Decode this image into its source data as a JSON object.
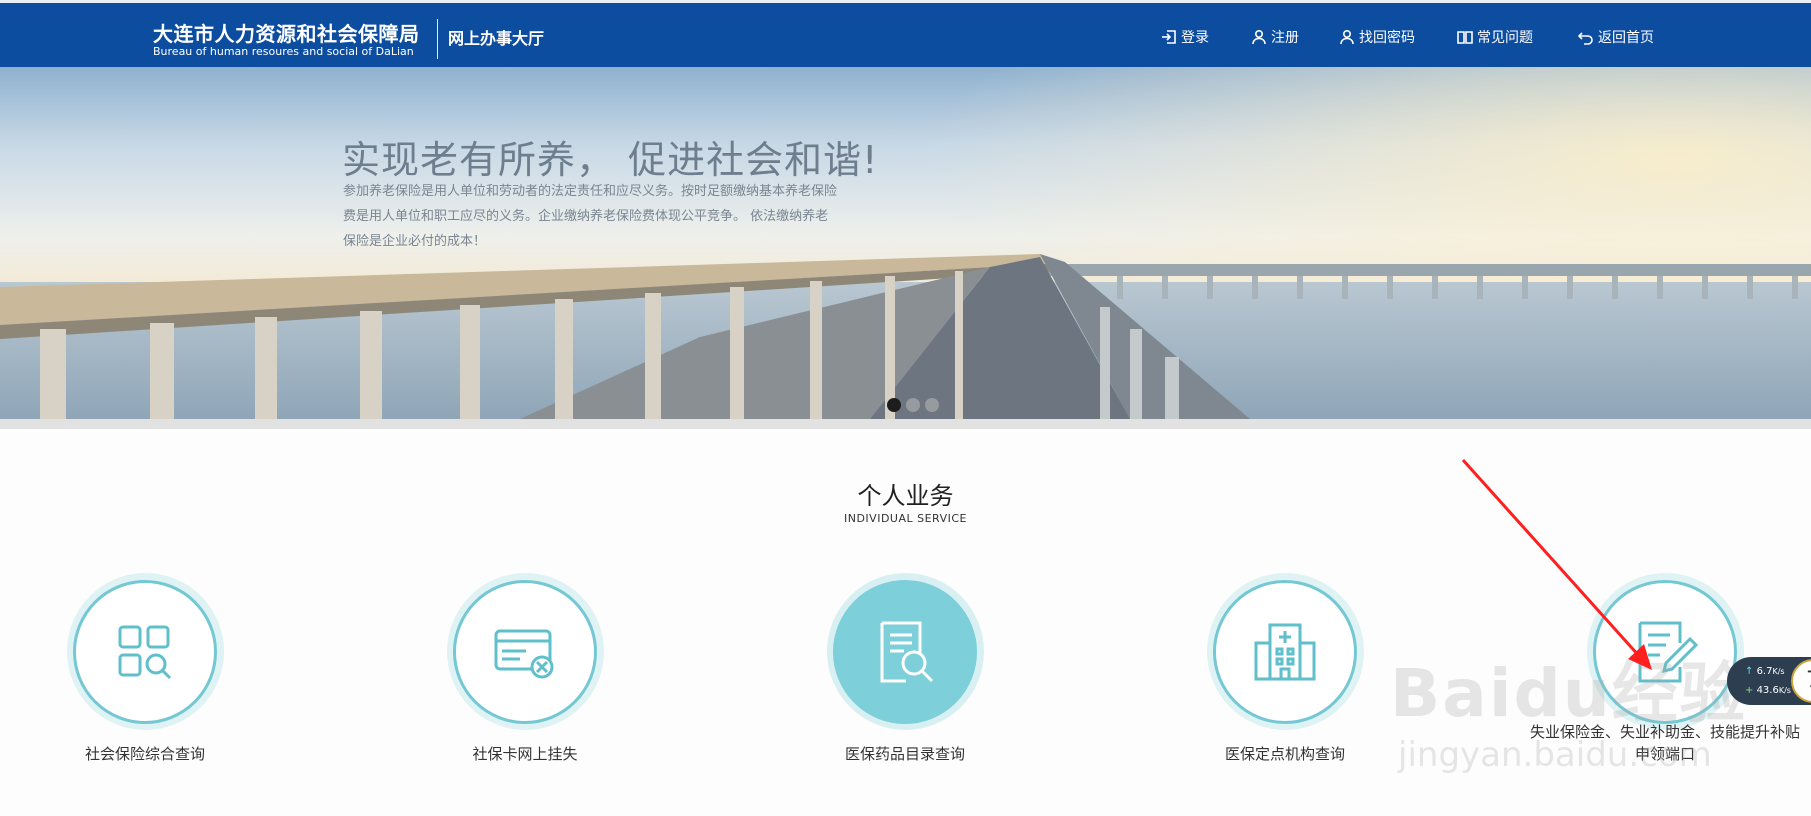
{
  "header": {
    "logo_cn": "大连市人力资源和社会保障局",
    "logo_en": "Bureau of human resoures and social of DaLian",
    "hall": "网上办事大厅",
    "nav": {
      "login": "登录",
      "register": "注册",
      "find_password": "找回密码",
      "faq": "常见问题",
      "home": "返回首页"
    }
  },
  "banner": {
    "title": "实现老有所养， 促进社会和谐!",
    "description": "参加养老保险是用人单位和劳动者的法定责任和应尽义务。按时足额缴纳基本养老保险费是用人单位和职工应尽的义务。企业缴纳养老保险费体现公平竞争。 依法缴纳养老保险是企业必付的成本！",
    "active_slide": 1,
    "slide_count": 3
  },
  "section": {
    "title": "个人业务",
    "subtitle": "INDIVIDUAL SERVICE"
  },
  "services": [
    {
      "label": "社会保险综合查询",
      "icon": "grid-search-icon"
    },
    {
      "label": "社保卡网上挂失",
      "icon": "card-cancel-icon"
    },
    {
      "label": "医保药品目录查询",
      "icon": "document-search-icon"
    },
    {
      "label": "医保定点机构查询",
      "icon": "hospital-icon"
    },
    {
      "label": "失业保险金、失业补助金、技能提升补贴申领端口",
      "icon": "document-edit-icon"
    }
  ],
  "watermark": {
    "brand": "Baidu经验",
    "url": "jingyan.baidu.com"
  },
  "speed_widget": {
    "upload": "6.7",
    "upload_unit": "K/s",
    "download": "43.6",
    "download_unit": "K/s",
    "badge": "7"
  },
  "colors": {
    "header_bg": "#0c4da0",
    "accent": "#74c8d3",
    "annotation": "#ff1f1f"
  }
}
